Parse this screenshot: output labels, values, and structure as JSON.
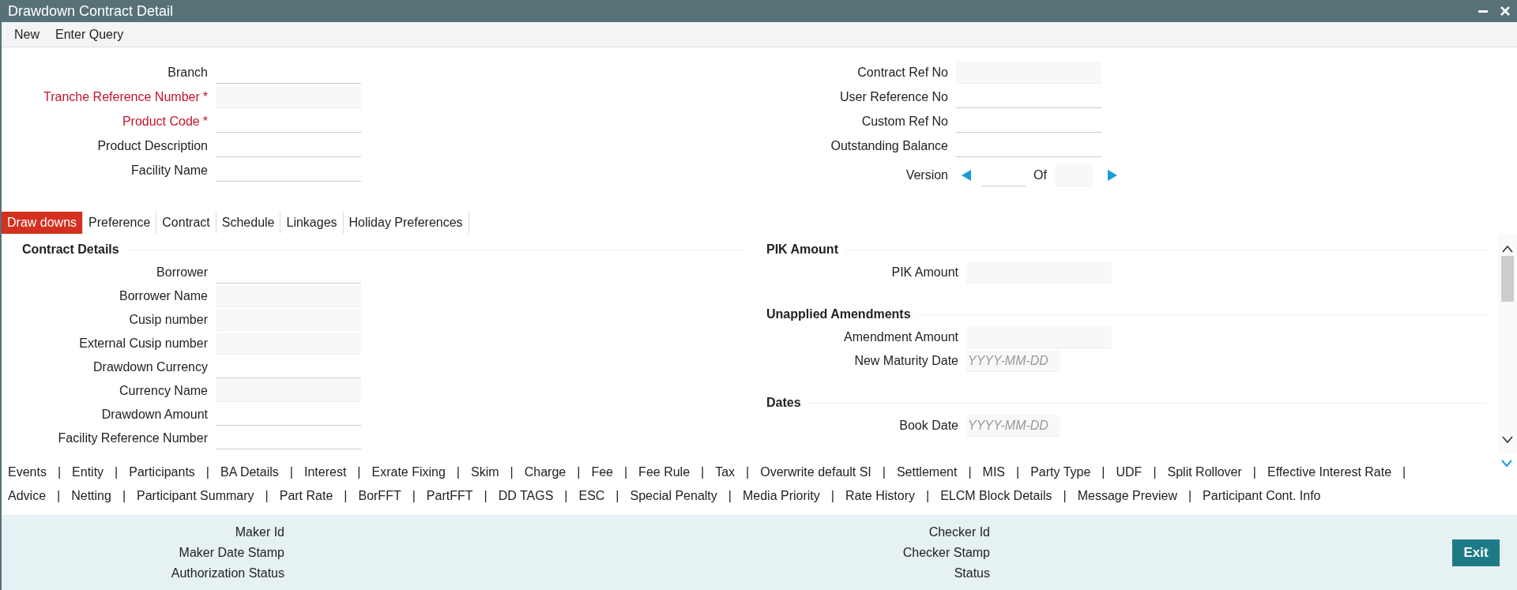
{
  "window": {
    "title": "Drawdown Contract Detail",
    "controls": [
      {
        "kind": "minimize"
      },
      {
        "kind": "close"
      }
    ]
  },
  "toolbar": [
    "New",
    "Enter Query"
  ],
  "header": {
    "left_fields": [
      {
        "label": "Branch",
        "kind": "input",
        "required": false
      },
      {
        "label": "Tranche Reference Number",
        "kind": "readonly",
        "required": true,
        "mark": "*"
      },
      {
        "label": "Product Code",
        "kind": "input",
        "required": true,
        "mark": "*"
      },
      {
        "label": "Product Description",
        "kind": "input",
        "required": false
      },
      {
        "label": "Facility Name",
        "kind": "input",
        "required": false
      }
    ],
    "right_fields": [
      {
        "label": "Contract Ref No",
        "kind": "readonly",
        "required": false
      },
      {
        "label": "User Reference No",
        "kind": "input",
        "required": false
      },
      {
        "label": "Custom Ref No",
        "kind": "input",
        "required": false
      },
      {
        "label": "Outstanding Balance",
        "kind": "input",
        "required": false
      }
    ],
    "version": {
      "label": "Version",
      "of": "Of"
    }
  },
  "tabs": [
    {
      "label": "Draw downs",
      "selected": true
    },
    {
      "label": "Preference",
      "selected": false
    },
    {
      "label": "Contract",
      "selected": false
    },
    {
      "label": "Schedule",
      "selected": false
    },
    {
      "label": "Linkages",
      "selected": false
    },
    {
      "label": "Holiday Preferences",
      "selected": false
    }
  ],
  "left_sections": [
    {
      "heading": "Contract Details",
      "fields": [
        {
          "label": "Borrower",
          "kind": "input"
        },
        {
          "label": "Borrower Name",
          "kind": "readonly"
        },
        {
          "label": "Cusip number",
          "kind": "readonly"
        },
        {
          "label": "External Cusip number",
          "kind": "readonly"
        },
        {
          "label": "Drawdown Currency",
          "kind": "input"
        },
        {
          "label": "Currency Name",
          "kind": "readonly"
        },
        {
          "label": "Drawdown Amount",
          "kind": "input"
        },
        {
          "label": "Facility Reference Number",
          "kind": "input"
        }
      ]
    }
  ],
  "right_sections": [
    {
      "heading": "PIK Amount",
      "fields": [
        {
          "label": "PIK Amount",
          "kind": "readonly"
        }
      ]
    },
    {
      "heading": "Unapplied Amendments",
      "fields": [
        {
          "label": "Amendment Amount",
          "kind": "readonly"
        },
        {
          "label": "New Maturity Date",
          "kind": "date",
          "placeholder": "YYYY-MM-DD"
        }
      ]
    },
    {
      "heading": "Dates",
      "fields": [
        {
          "label": "Book Date",
          "kind": "date",
          "placeholder": "YYYY-MM-DD"
        }
      ]
    }
  ],
  "links": {
    "separator": "|",
    "rows": [
      {
        "items": [
          "Events",
          "Entity",
          "Participants",
          "BA Details",
          "Interest",
          "Exrate Fixing",
          "Skim",
          "Charge",
          "Fee",
          "Fee Rule",
          "Tax",
          "Overwrite default SI",
          "Settlement",
          "MIS",
          "Party Type",
          "UDF",
          "Split Rollover",
          "Effective Interest Rate"
        ],
        "trailing_separator": true
      },
      {
        "items": [
          "Advice",
          "Netting",
          "Participant Summary",
          "Part Rate",
          "BorFFT",
          "PartFFT",
          "DD TAGS",
          "ESC",
          "Special Penalty",
          "Media Priority",
          "Rate History",
          "ELCM Block Details",
          "Message Preview",
          "Participant Cont. Info"
        ],
        "trailing_separator": false
      }
    ]
  },
  "audit": {
    "left": [
      "Maker Id",
      "Maker Date Stamp",
      "Authorization Status"
    ],
    "right": [
      "Checker Id",
      "Checker Stamp",
      "Status"
    ]
  },
  "buttons": [
    "Exit"
  ]
}
